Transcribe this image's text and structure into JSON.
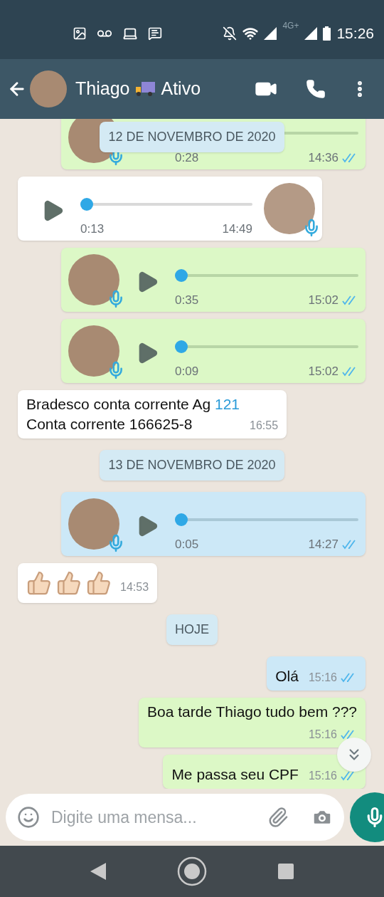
{
  "status_bar": {
    "network": "4G+",
    "time": "15:26"
  },
  "header": {
    "name": "Thiago",
    "status": "Ativo"
  },
  "sticky_date": "12 DE NOVEMBRO DE 2020",
  "messages": [
    {
      "kind": "voice",
      "outgoing": true,
      "selected": false,
      "duration": "0:28",
      "time": "14:36",
      "read": true
    },
    {
      "kind": "voice",
      "outgoing": false,
      "selected": false,
      "duration": "0:13",
      "time": "14:49",
      "level": 0
    },
    {
      "kind": "voice",
      "outgoing": true,
      "selected": false,
      "duration": "0:35",
      "time": "15:02",
      "read": true,
      "level": 0
    },
    {
      "kind": "voice",
      "outgoing": true,
      "selected": false,
      "duration": "0:09",
      "time": "15:02",
      "read": true,
      "level": 0
    },
    {
      "kind": "text",
      "outgoing": false,
      "selected": false,
      "wrap_time": false,
      "segments": [
        {
          "kind": "plain",
          "text": "Bradesco conta corrente Ag "
        },
        {
          "kind": "link",
          "text": "121"
        },
        {
          "kind": "plain",
          "text": "\nConta corrente 166625-8"
        }
      ],
      "time": "16:55"
    },
    {
      "kind": "date",
      "text": "13 DE NOVEMBRO DE 2020"
    },
    {
      "kind": "voice",
      "outgoing": true,
      "selected": true,
      "duration": "0:05",
      "time": "14:27",
      "read": true,
      "level": 0
    },
    {
      "kind": "emoji",
      "outgoing": false,
      "selected": false,
      "icons": [
        {
          "kind": "thumbs-up"
        },
        {
          "kind": "thumbs-up"
        },
        {
          "kind": "thumbs-up"
        }
      ],
      "time": "14:53"
    },
    {
      "kind": "date",
      "text": "HOJE"
    },
    {
      "kind": "text",
      "outgoing": true,
      "selected": true,
      "wrap_time": false,
      "segments": [
        {
          "kind": "plain",
          "text": "Olá"
        }
      ],
      "time": "15:16",
      "read": true
    },
    {
      "kind": "text",
      "outgoing": true,
      "selected": false,
      "wrap_time": true,
      "segments": [
        {
          "kind": "plain",
          "text": "Boa tarde Thiago tudo bem ???"
        }
      ],
      "time": "15:16",
      "read": true
    },
    {
      "kind": "text",
      "outgoing": true,
      "selected": false,
      "wrap_time": false,
      "segments": [
        {
          "kind": "plain",
          "text": "Me passa seu CPF"
        }
      ],
      "time": "15:16",
      "read": true
    }
  ],
  "input": {
    "placeholder": "Digite uma mensa..."
  }
}
